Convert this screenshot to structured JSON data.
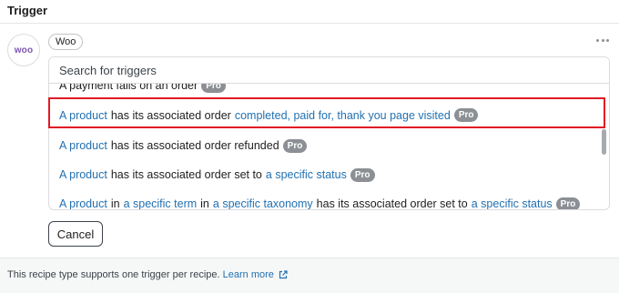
{
  "header": {
    "title": "Trigger"
  },
  "integration": {
    "logo_text": "woo",
    "tag_label": "Woo"
  },
  "search": {
    "placeholder": "Search for triggers",
    "value": ""
  },
  "options": [
    {
      "segments": [
        {
          "text": "A payment fails on an order",
          "link": false
        }
      ],
      "badge": "Pro",
      "partial": true
    },
    {
      "segments": [
        {
          "text": "A product",
          "link": true
        },
        {
          "text": "has its associated order",
          "link": false
        },
        {
          "text": "completed, paid for, thank you page visited",
          "link": true
        }
      ],
      "badge": "Pro",
      "highlighted": true
    },
    {
      "segments": [
        {
          "text": "A product",
          "link": true
        },
        {
          "text": "has its associated order refunded",
          "link": false
        }
      ],
      "badge": "Pro"
    },
    {
      "segments": [
        {
          "text": "A product",
          "link": true
        },
        {
          "text": "has its associated order set to",
          "link": false
        },
        {
          "text": "a specific status",
          "link": true
        }
      ],
      "badge": "Pro"
    },
    {
      "segments": [
        {
          "text": "A product",
          "link": true
        },
        {
          "text": "in",
          "link": false
        },
        {
          "text": "a specific term",
          "link": true
        },
        {
          "text": "in",
          "link": false
        },
        {
          "text": "a specific taxonomy",
          "link": true
        },
        {
          "text": "has its associated order set to",
          "link": false
        },
        {
          "text": "a specific status",
          "link": true
        }
      ],
      "badge": "Pro"
    }
  ],
  "actions": {
    "cancel_label": "Cancel"
  },
  "footer": {
    "text": "This recipe type supports one trigger per recipe.",
    "link_label": "Learn more"
  },
  "colors": {
    "link": "#2271b1",
    "highlight": "#e01b24",
    "badge": "#8c8f94",
    "brand_purple": "#7f54b3"
  },
  "icons": [
    "more-options-icon",
    "external-link-icon"
  ]
}
